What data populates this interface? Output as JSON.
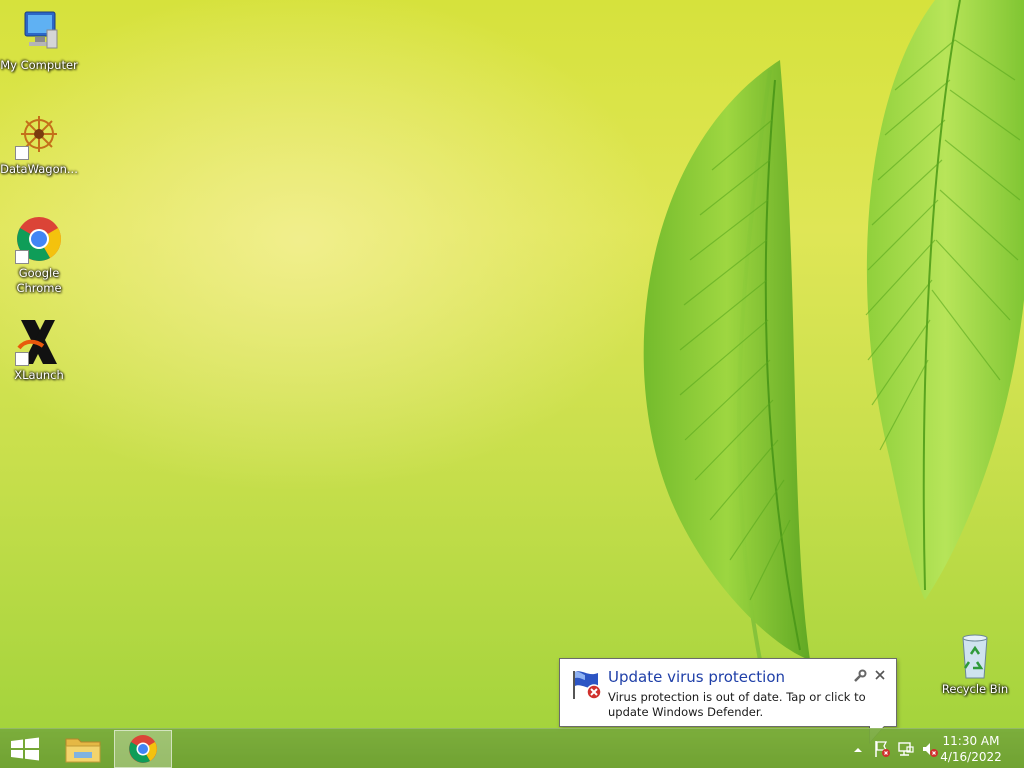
{
  "desktop": {
    "icons": [
      {
        "label": "My Computer",
        "icon": "computer-icon"
      },
      {
        "label": "DataWagon...",
        "icon": "datawagon-icon"
      },
      {
        "label": "Google Chrome",
        "icon": "chrome-icon"
      },
      {
        "label": "XLaunch",
        "icon": "xlaunch-icon"
      },
      {
        "label": "Recycle Bin",
        "icon": "recycle-bin-icon"
      }
    ]
  },
  "notification": {
    "title": "Update virus protection",
    "body": "Virus protection is out of date. Tap or click to update Windows Defender.",
    "icon": "shield-flag-error-icon",
    "title_color": "#1f3fa8"
  },
  "taskbar": {
    "pinned": [
      {
        "icon": "windows-logo-icon"
      },
      {
        "icon": "file-explorer-icon"
      },
      {
        "icon": "chrome-icon"
      }
    ],
    "tray": [
      {
        "icon": "chevron-up-icon"
      },
      {
        "icon": "action-center-flag-icon"
      },
      {
        "icon": "network-icon"
      },
      {
        "icon": "volume-muted-icon"
      }
    ],
    "clock": {
      "time": "11:30 AM",
      "date": "4/16/2022"
    }
  }
}
